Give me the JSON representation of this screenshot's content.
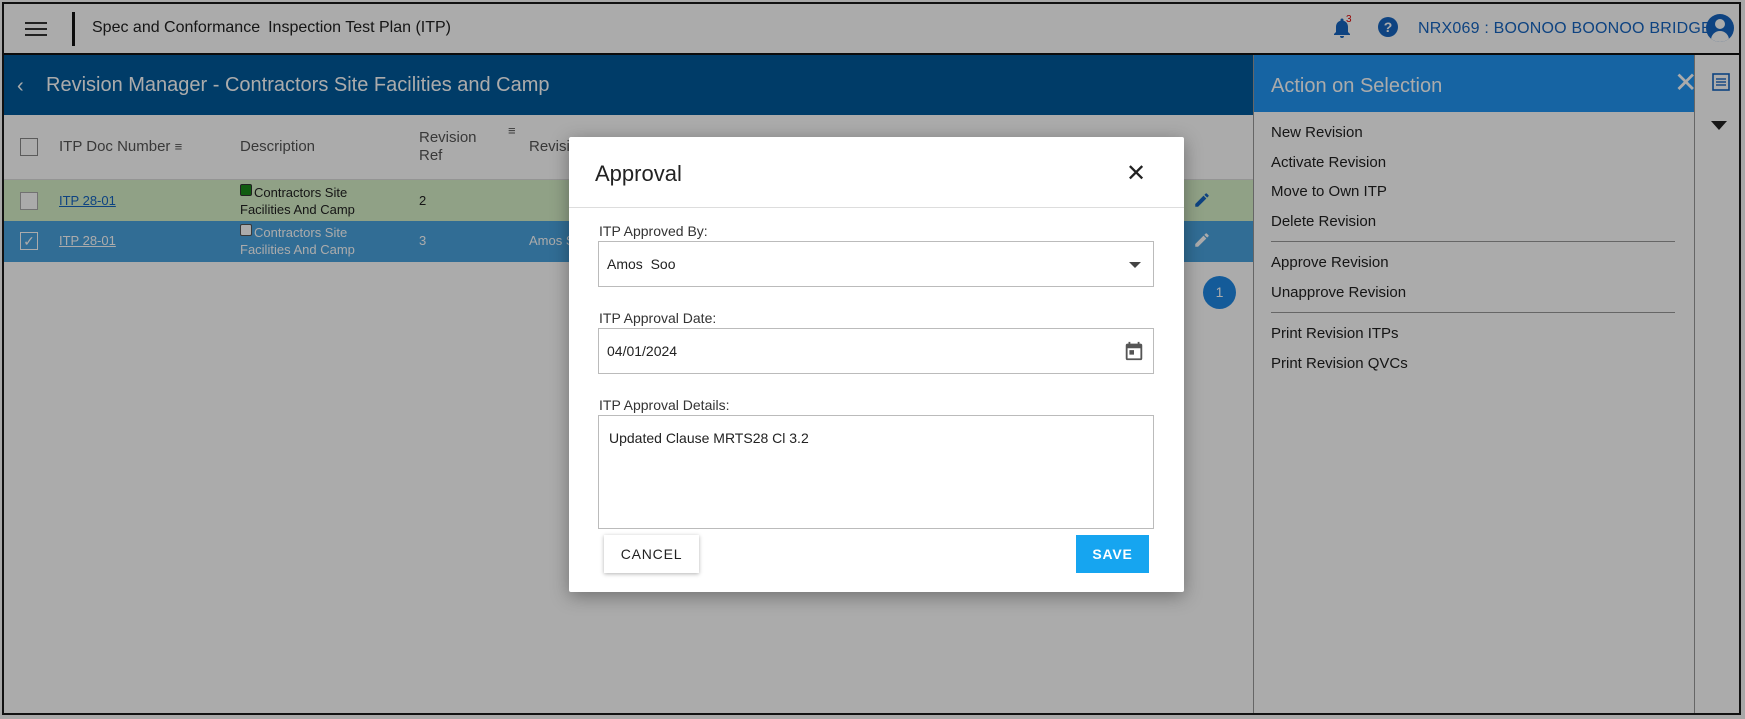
{
  "topbar": {
    "app_name": "Spec and Conformance",
    "module": "Inspection Test Plan (ITP)",
    "notification_count": "3",
    "help": "?",
    "project": "NRX069 : BOONOO BOONOO BRIDGE"
  },
  "revision_header": {
    "title": "Revision Manager - Contractors Site Facilities and Camp"
  },
  "table": {
    "columns": [
      "ITP Doc Number",
      "Description",
      "Revision Ref",
      "Revisi"
    ],
    "rows": [
      {
        "doc": "ITP 28-01",
        "description": "Contractors Site Facilities And Camp",
        "rev_ref": "2",
        "approver": "",
        "checked": false,
        "status_color": "#1a8a1a"
      },
      {
        "doc": "ITP 28-01",
        "description": "Contractors Site Facilities And Camp",
        "rev_ref": "3",
        "approver": "Amos S",
        "checked": true,
        "status_color": "#ffffff"
      }
    ],
    "page": "1"
  },
  "action_panel": {
    "title": "Action on Selection",
    "group1": [
      "New Revision",
      "Activate Revision",
      "Move to Own ITP",
      "Delete Revision"
    ],
    "group2": [
      "Approve Revision",
      "Unapprove Revision"
    ],
    "group3": [
      "Print Revision ITPs",
      "Print Revision QVCs"
    ]
  },
  "modal": {
    "title": "Approval",
    "approved_by_label": "ITP Approved By:",
    "approved_by_value": "Amos  Soo",
    "date_label": "ITP Approval Date:",
    "date_value": "04/01/2024",
    "details_label": "ITP Approval Details:",
    "details_value": "Updated Clause MRTS28 Cl 3.2",
    "cancel_label": "CANCEL",
    "save_label": "SAVE"
  },
  "colors": {
    "header_blue": "#005a9c",
    "panel_blue": "#2196f3",
    "selected_row": "#4aa3df",
    "active_row": "#d7f0c8",
    "save_button": "#16a5f0"
  }
}
